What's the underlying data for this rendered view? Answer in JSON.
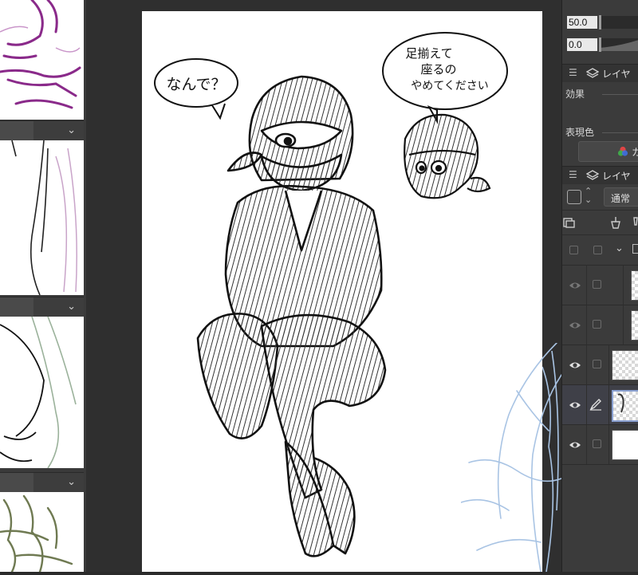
{
  "tool_property": {
    "field_1_value": "50.0",
    "field_2_value": "0.0"
  },
  "layer_property_palette": {
    "title": "レイヤ",
    "effect_label": "効果",
    "expression_color_label": "表現色",
    "expression_color_value": "カ"
  },
  "layer_palette": {
    "title": "レイヤ",
    "blend_mode": "通常",
    "rows": [
      {
        "name": "folder-row",
        "visible": false
      },
      {
        "name": "layer-row-1",
        "visible": true
      },
      {
        "name": "layer-row-2",
        "visible": true
      },
      {
        "name": "layer-row-3",
        "visible": true
      },
      {
        "name": "layer-row-4-selected",
        "visible": true
      },
      {
        "name": "paper-layer-row",
        "visible": true
      }
    ]
  },
  "canvas": {
    "speech_bubble_1": "なんで？",
    "speech_bubble_2_line1": "足揃えて",
    "speech_bubble_2_line2": "座るの",
    "speech_bubble_2_line3": "やめてください"
  },
  "icons": [
    "chevron-down-icon",
    "hamburger-icon",
    "layers-icon",
    "eye-icon",
    "pen-icon",
    "color-wheel-icon",
    "lock-icon",
    "clip-icon"
  ],
  "colors": {
    "ui_dark": "#2b2b2b",
    "panel_bg": "#3b3b3b",
    "ink": "#111111",
    "sketch_purple": "#8a2a8a",
    "sketch_blue": "#a9c4e4",
    "sketch_green": "#6f7a52"
  }
}
